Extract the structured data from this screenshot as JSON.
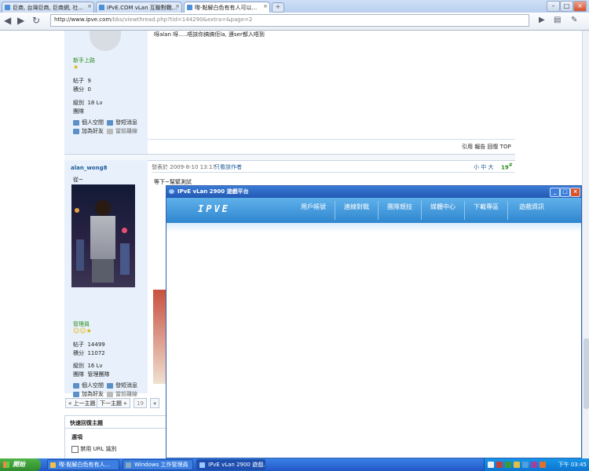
{
  "browser": {
    "tabs": [
      {
        "title": "巨商, 台灣巨商, 巨商網, 社...",
        "active": false
      },
      {
        "title": "IPvE.COM vLan 互聯對戰...",
        "active": false
      },
      {
        "title": "嚟-點解白色有有人可以...",
        "active": false
      }
    ],
    "active_tab": {
      "title": "嚟-點解白色有有人可以..."
    },
    "new_tab": "+",
    "url_host": "http://www.ipve.com",
    "url_path": "/bbs/viewthread.php?tid=144290&extra=&page=2",
    "window_controls": {
      "minimize": "–",
      "maximize": "□",
      "close": "×"
    }
  },
  "forum": {
    "post1": {
      "rank": "新手上路",
      "stats": [
        {
          "label": "帖子",
          "value": "9"
        },
        {
          "label": "積分",
          "value": "0"
        }
      ],
      "level_label": "級別",
      "level": "18 Lv",
      "group_label": "團隊",
      "space": "個人空間",
      "pm": "發短消息",
      "add_friend": "加為好友",
      "online": "當前離線",
      "message": "呀alan 呀.....唔該你搞搞佢la, 連ser都入唔到",
      "actions": "引用 報告 回復 TOP"
    },
    "post2": {
      "username": "alan_wong8",
      "signature": "從~",
      "posted_label": "發表於",
      "posted_time": "2009-8-10 13:17",
      "only_author": "只看該作者",
      "font_sizes": "小 中 大",
      "floor": "19",
      "message": "等下~幫緊測試",
      "rank": "管理員",
      "stats": [
        {
          "label": "帖子",
          "value": "14499"
        },
        {
          "label": "積分",
          "value": "11072"
        }
      ],
      "level_label": "級別",
      "level": "16 Lv",
      "group_label": "團隊",
      "group": "管理團隊",
      "space": "個人空間",
      "pm": "發短消息",
      "add_friend": "加為好友",
      "online": "當前離線"
    },
    "pagination": {
      "prev": "« 上一主題",
      "next": "下一主題 »",
      "page_num": "19",
      "first": "«"
    },
    "quick_reply": {
      "title": "快速回復主題",
      "options": "選項",
      "disable_url": "禁用 URL 識別"
    }
  },
  "popup": {
    "title": "IPvE vLan 2900 遊戲平台",
    "logo": "IPVE",
    "menu": [
      "用戶帳號",
      "連線對戰",
      "團隊競技",
      "媒體中心",
      "下載專區",
      "遊戲資訊"
    ],
    "controls": {
      "minimize": "_",
      "maximize": "□",
      "close": "×"
    }
  },
  "taskbar": {
    "start": "開始",
    "tasks": [
      {
        "label": "嚟-點解白色有有人...",
        "active": false
      },
      {
        "label": "Windows 工作管理員",
        "active": false
      },
      {
        "label": "IPvE vLan 2900 遊戲...",
        "active": true
      }
    ],
    "clock": "下午 03:45"
  }
}
